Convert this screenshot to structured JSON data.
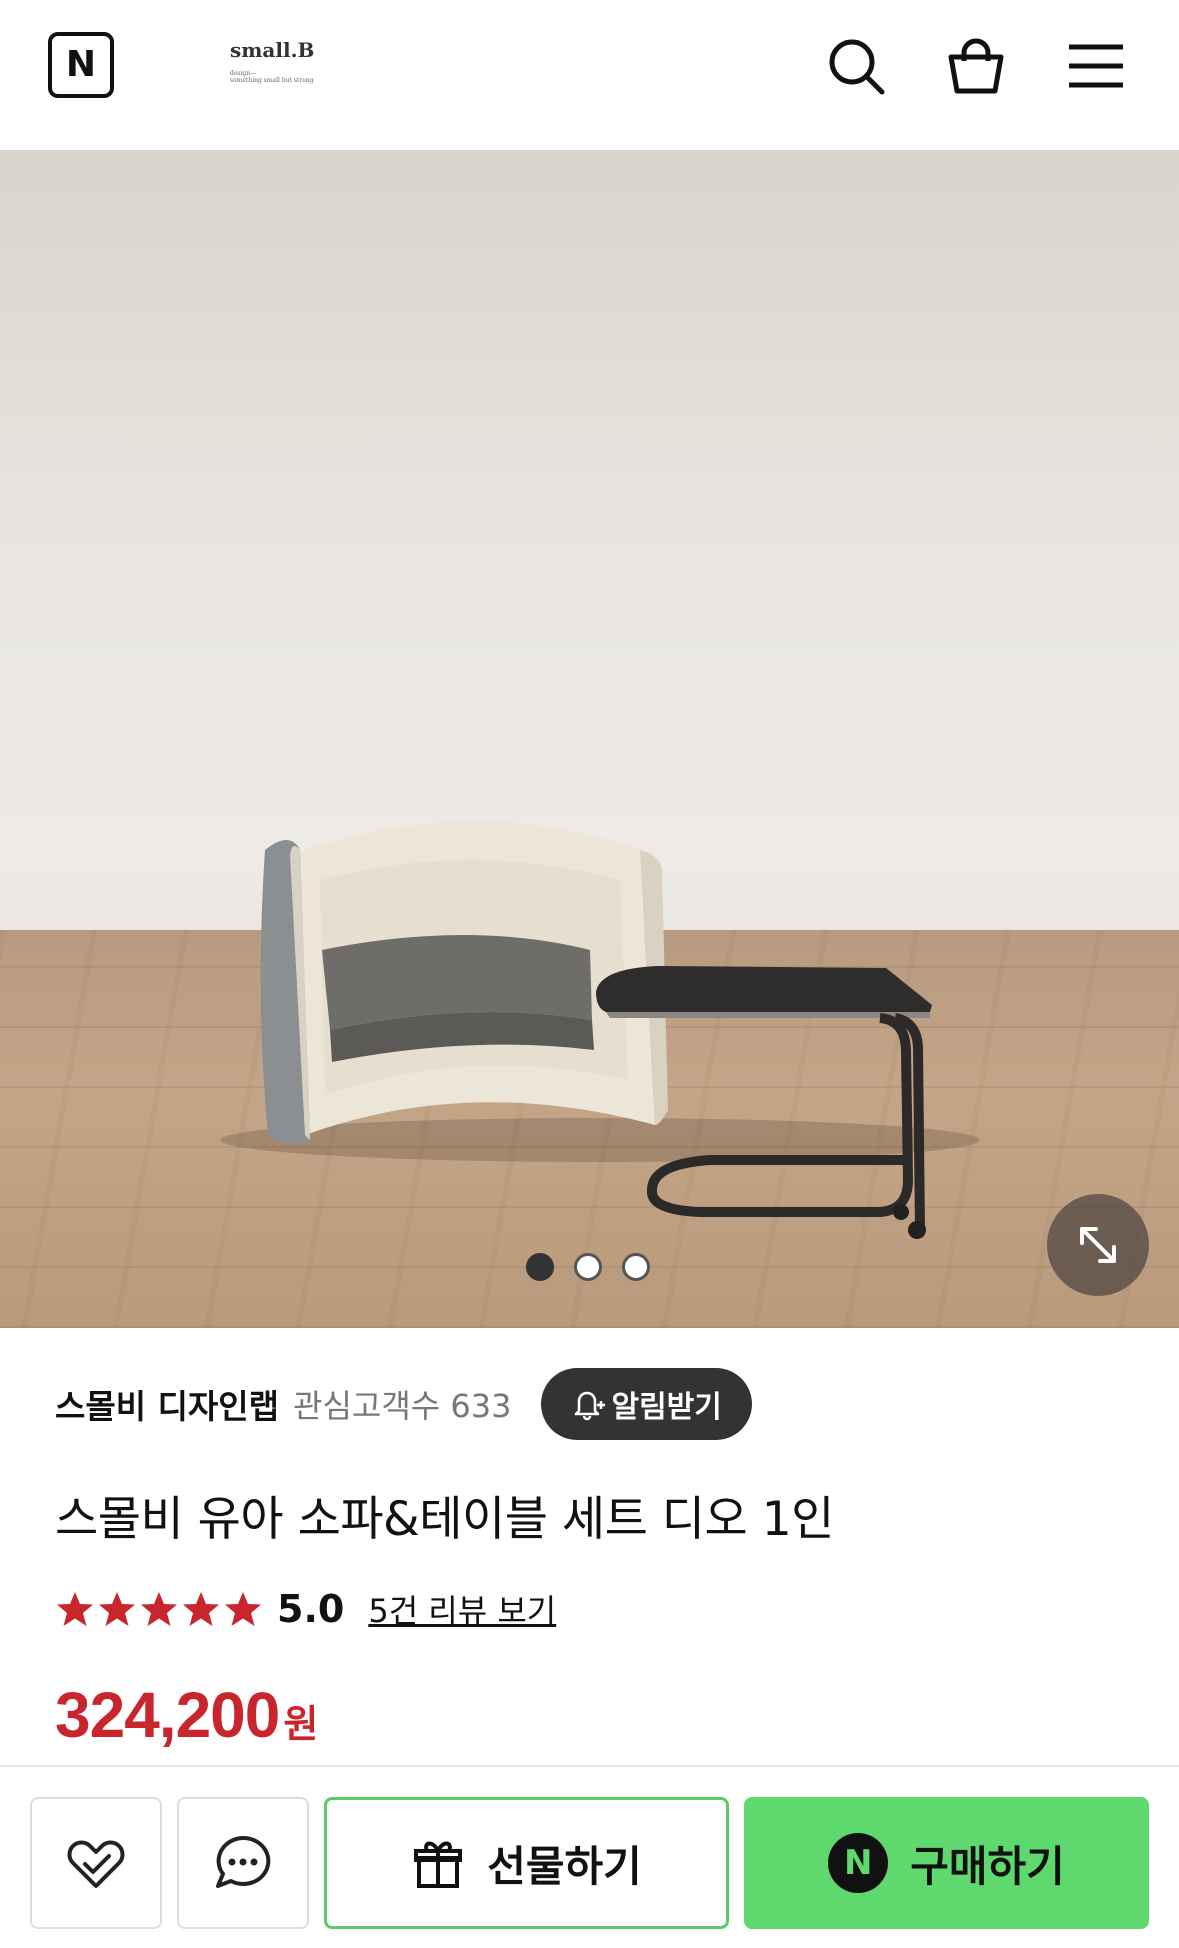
{
  "header": {
    "logo_letter": "N",
    "brand_name": "small.B",
    "brand_line1": "design—",
    "brand_line2": "something small but strong",
    "icons": [
      "search-icon",
      "shopping-bag-icon",
      "menu-icon"
    ]
  },
  "gallery": {
    "image_description_icon": "product-photo",
    "page_count": 3,
    "current_page": 1
  },
  "store": {
    "name": "스몰비 디자인랩",
    "followers_label": "관심고객수 633",
    "notify_label": "알림받기"
  },
  "product": {
    "title": "스몰비 유아 소파&테이블 세트 디오 1인",
    "rating": "5.0",
    "stars": 5,
    "review_link": "5건 리뷰 보기",
    "price": "324,200",
    "currency": "원"
  },
  "bottom_bar": {
    "gift_label": "선물하기",
    "buy_label": "구매하기",
    "buy_logo_letter": "N"
  },
  "colors": {
    "price_red": "#c8252c",
    "star_red": "#c8252c",
    "buy_green": "#5fd96e",
    "gift_border_green": "#5ccb6a",
    "notify_bg": "#333333"
  }
}
